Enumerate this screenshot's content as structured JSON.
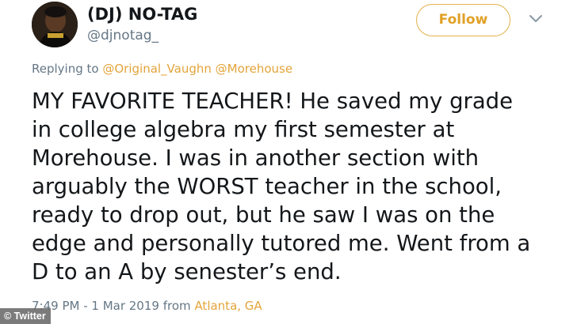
{
  "author": {
    "display_name": "(DJ) NO-TAG",
    "handle": "@djnotag_",
    "avatar_icon": "profile-photo"
  },
  "follow_label": "Follow",
  "menu_icon": "chevron-down-icon",
  "reply": {
    "prefix": "Replying to",
    "mentions": [
      "@Original_Vaughn",
      "@Morehouse"
    ]
  },
  "tweet_text": "MY FAVORITE TEACHER! He saved my grade\nin college algebra my first semester at\nMorehouse. I was in another section with\narguably the WORST teacher in the school,\nready to drop out, but he saw I was on the\nedge and personally tutored me. Went from a\nD to an A by senester’s end.",
  "meta": {
    "timestamp": "7:49 PM - 1 Mar 2019",
    "from": "from",
    "location": "Atlanta, GA"
  },
  "credit": "© Twitter",
  "colors": {
    "accent": "#e3a43a",
    "muted_text": "#657786",
    "main_text": "#14171a"
  }
}
